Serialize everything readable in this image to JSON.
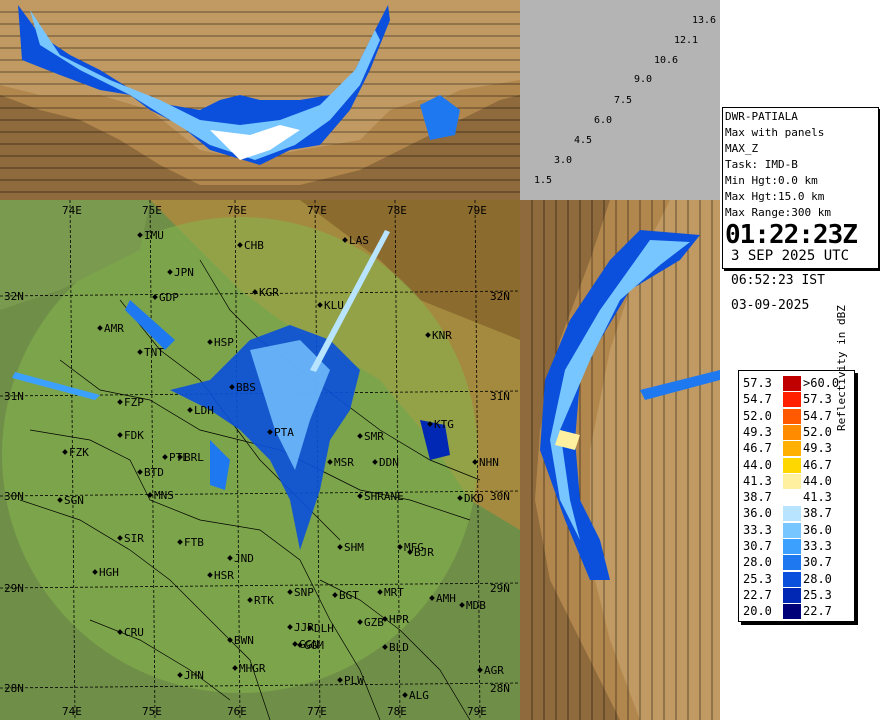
{
  "info": {
    "station": "DWR-PATIALA",
    "product": "Max with panels",
    "product_code": "MAX_Z",
    "task": "Task: IMD-B",
    "min_hgt": "Min Hgt:0.0 km",
    "max_hgt": "Max Hgt:15.0 km",
    "max_range": "Max Range:300 km",
    "time_utc": "01:22:23Z",
    "date_utc": "3 SEP 2025 UTC",
    "time_ist": "06:52:23 IST",
    "date_local": "03-09-2025"
  },
  "heights": [
    "1.5",
    "3.0",
    "4.5",
    "6.0",
    "7.5",
    "9.0",
    "10.6",
    "12.1",
    "13.6"
  ],
  "scale": {
    "title": "Reflectivity in dBZ",
    "rows": [
      {
        "lo": "57.3",
        "hi": ">60.0",
        "color": "#c00000"
      },
      {
        "lo": "54.7",
        "hi": "57.3",
        "color": "#ff2000"
      },
      {
        "lo": "52.0",
        "hi": "54.7",
        "color": "#ff5a00"
      },
      {
        "lo": "49.3",
        "hi": "52.0",
        "color": "#ff8c00"
      },
      {
        "lo": "46.7",
        "hi": "49.3",
        "color": "#ffb000"
      },
      {
        "lo": "44.0",
        "hi": "46.7",
        "color": "#ffd700"
      },
      {
        "lo": "41.3",
        "hi": "44.0",
        "color": "#fff0a0"
      },
      {
        "lo": "38.7",
        "hi": "41.3",
        "color": "#ffffff"
      },
      {
        "lo": "36.0",
        "hi": "38.7",
        "color": "#b8e4ff"
      },
      {
        "lo": "33.3",
        "hi": "36.0",
        "color": "#78c6ff"
      },
      {
        "lo": "30.7",
        "hi": "33.3",
        "color": "#3ca0ff"
      },
      {
        "lo": "28.0",
        "hi": "30.7",
        "color": "#1e78f0"
      },
      {
        "lo": "25.3",
        "hi": "28.0",
        "color": "#0a50dc"
      },
      {
        "lo": "22.7",
        "hi": "25.3",
        "color": "#0028b4"
      },
      {
        "lo": "20.0",
        "hi": "22.7",
        "color": "#000078"
      }
    ]
  },
  "map": {
    "lat_labels": [
      "32N",
      "31N",
      "30N",
      "29N",
      "28N"
    ],
    "lon_labels": [
      "74E",
      "75E",
      "76E",
      "77E",
      "78E",
      "79E"
    ],
    "stations": [
      "IMU",
      "CHB",
      "LAS",
      "JPN",
      "KGR",
      "GDP",
      "KLU",
      "AMR",
      "TNT",
      "HSP",
      "KNR",
      "BBS",
      "FZP",
      "LDH",
      "PTA",
      "FDK",
      "FZK",
      "PTL",
      "BTD",
      "MNS",
      "SGN",
      "SIR",
      "HGH",
      "FTB",
      "JND",
      "HSR",
      "SHM",
      "MFG",
      "BJR",
      "RTK",
      "SNP",
      "BGT",
      "MRT",
      "AMH",
      "MDB",
      "BWN",
      "DLH",
      "JJR",
      "GGN",
      "GZB",
      "HPR",
      "CRU",
      "GGM",
      "BLD",
      "MHGR",
      "PLW",
      "JHN",
      "ALG",
      "AGR",
      "KTG",
      "BRL",
      "SMR",
      "DDN",
      "SHRANE",
      "NHN",
      "MSR",
      "DKD"
    ]
  }
}
